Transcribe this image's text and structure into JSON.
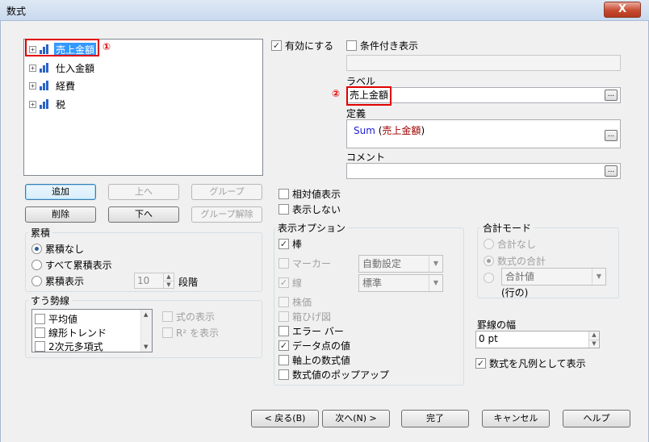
{
  "window": {
    "title": "数式",
    "close_label": "X"
  },
  "tree": {
    "items": [
      {
        "label": "売上金額",
        "expander": "+"
      },
      {
        "label": "仕入金額",
        "expander": "+"
      },
      {
        "label": "経費",
        "expander": "+"
      },
      {
        "label": "税",
        "expander": "+"
      }
    ],
    "icon": "bar-chart-icon"
  },
  "annotations": {
    "one": "①",
    "two": "②",
    "color": "#e00000"
  },
  "list_buttons": {
    "add": "追加",
    "up": "上へ",
    "group": "グループ",
    "delete": "削除",
    "down": "下へ",
    "ungroup": "グループ解除"
  },
  "accumulation": {
    "title": "累積",
    "options": [
      "累積なし",
      "すべて累積表示",
      "累積表示"
    ],
    "selected": "累積なし",
    "steps_value": "10",
    "steps_label": "段階"
  },
  "trendline": {
    "title": "すう勢線",
    "items": [
      "平均値",
      "線形トレンド",
      "2次元多項式"
    ],
    "show_formula": "式の表示",
    "show_r2": "R² を表示"
  },
  "enable": {
    "label": "有効にする",
    "checked": "✓"
  },
  "conditional": {
    "label": "条件付き表示",
    "value": ""
  },
  "label_field": {
    "caption": "ラベル",
    "value": "売上金額",
    "button": "..."
  },
  "definition": {
    "caption": "定義",
    "function": "Sum",
    "open": " (",
    "field": "売上金額",
    "close": ")",
    "button": "..."
  },
  "comment": {
    "caption": "コメント",
    "value": "",
    "button": "..."
  },
  "relative": {
    "label": "相対値表示"
  },
  "invisible": {
    "label": "表示しない"
  },
  "display_options": {
    "title": "表示オプション",
    "bar": "棒",
    "marker": "マーカー",
    "marker_value": "自動設定",
    "line": "線",
    "line_value": "標準",
    "candlestick": "株価",
    "boxplot": "箱ひげ図",
    "error_bar": "エラー バー",
    "data_values": "データ点の値",
    "axis_values": "軸上の数式値",
    "popup": "数式値のポップアップ",
    "check": "✓"
  },
  "total_mode": {
    "title": "合計モード",
    "none": "合計なし",
    "expression_total": "数式の合計",
    "combo_value": "合計値",
    "rows_label": "(行の)"
  },
  "line_width": {
    "caption": "罫線の幅",
    "value": "0 pt"
  },
  "legend": {
    "label": "数式を凡例として表示",
    "check": "✓"
  },
  "footer": {
    "back": "< 戻る(B)",
    "next": "次へ(N) >",
    "finish": "完了",
    "cancel": "キャンセル",
    "help": "ヘルプ"
  }
}
